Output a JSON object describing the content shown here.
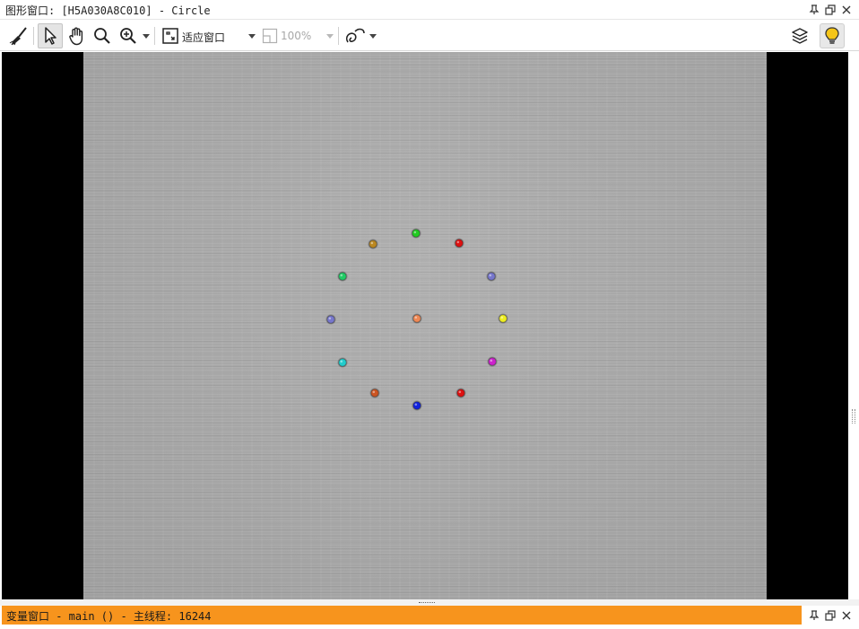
{
  "window": {
    "title": "图形窗口: [H5A030A8C010] - Circle"
  },
  "toolbar": {
    "fit_window_label": "适应窗口",
    "zoom_label": "100%"
  },
  "icons": {
    "clear": "broom-icon",
    "pointer": "pointer-icon",
    "pan": "hand-icon",
    "magnify": "magnifier-icon",
    "zoom": "zoom-in-icon",
    "fit": "fit-window-icon",
    "zoom_box": "zoom-box-icon",
    "draw": "draw-shape-icon",
    "layers": "layers-icon",
    "hint": "lightbulb-icon",
    "pin": "pin-icon",
    "float": "float-window-icon",
    "close": "close-icon"
  },
  "image": {
    "background_color": "#a9a9a9",
    "points": [
      {
        "color": "#22cc22"
      },
      {
        "color": "#dd1111"
      },
      {
        "color": "#7777cc"
      },
      {
        "color": "#eeee22"
      },
      {
        "color": "#cc22cc"
      },
      {
        "color": "#dd1111"
      },
      {
        "color": "#1122dd"
      },
      {
        "color": "#cc5522"
      },
      {
        "color": "#22cccc"
      },
      {
        "color": "#7777cc"
      },
      {
        "color": "#22cc66"
      },
      {
        "color": "#bb8822"
      },
      {
        "color": "#ee8855"
      }
    ]
  },
  "variable_window": {
    "title": "变量窗口 - main () - 主线程: 16244",
    "color": "#f7941d"
  }
}
